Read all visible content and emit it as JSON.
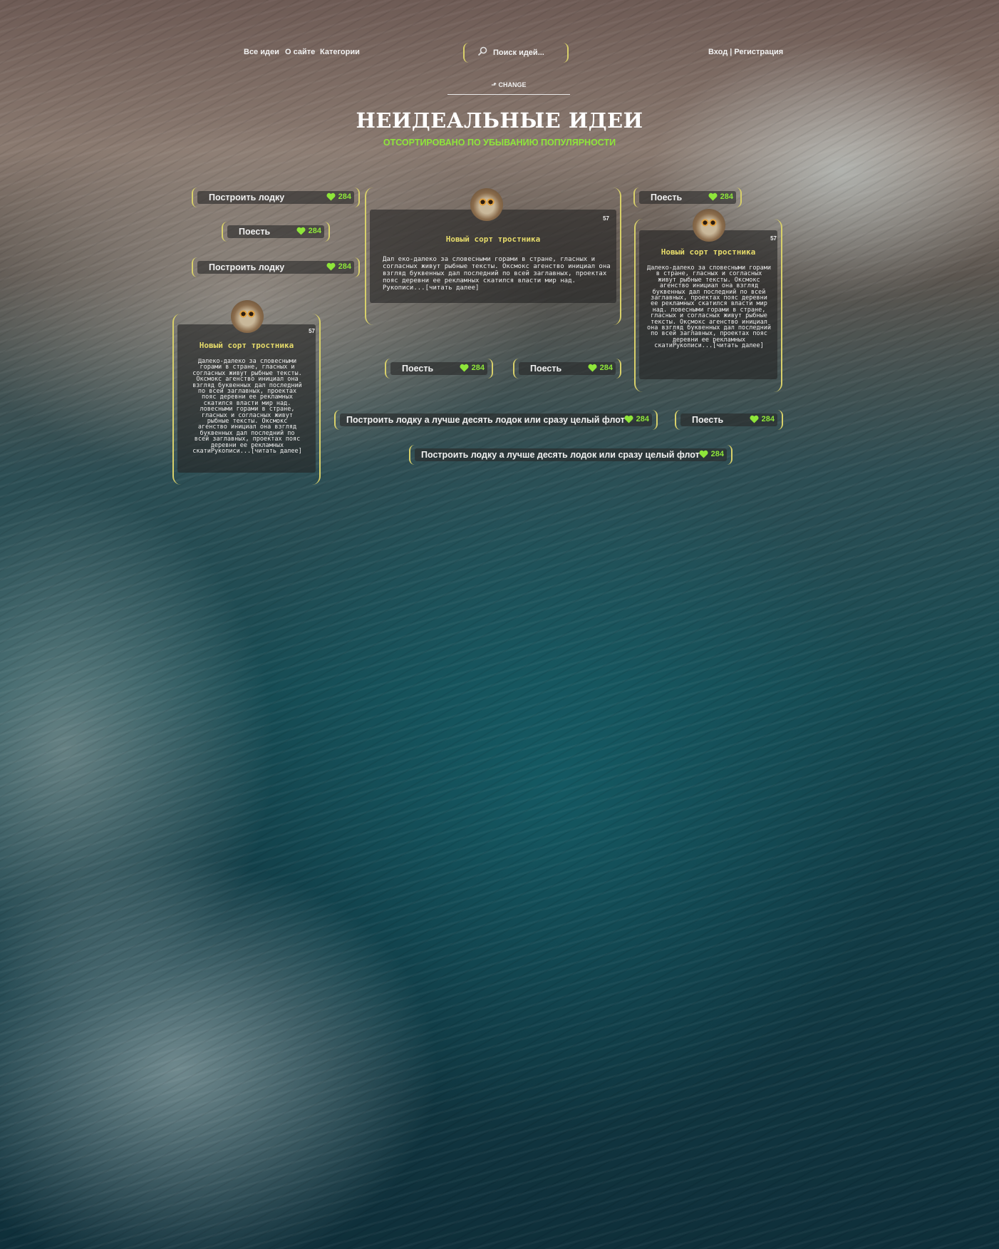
{
  "nav": {
    "items": [
      "Все идеи",
      "О сайте",
      "Категории"
    ]
  },
  "search": {
    "placeholder": "Поиск идей..."
  },
  "auth": {
    "login": "Вход",
    "separator": "|",
    "register": "Регистрация"
  },
  "change_label": "CHANGE",
  "heading": {
    "title": "НЕИДЕАЛЬНЫЕ ИДЕИ",
    "subtitle": "ОТСОРТИРОВАНО ПО УБЫВАНИЮ ПОПУЛЯРНОСТИ"
  },
  "colors": {
    "accent": "#8ee63a",
    "frame": "#d8d06a",
    "card_title": "#e6db6a"
  },
  "pills": [
    {
      "title": "Построить лодку",
      "likes": "284"
    },
    {
      "title": "Поесть",
      "likes": "284"
    },
    {
      "title": "Построить лодку",
      "likes": "284"
    },
    {
      "title": "Поесть",
      "likes": "284"
    },
    {
      "title": "Поесть",
      "likes": "284"
    },
    {
      "title": "Поесть",
      "likes": "284"
    },
    {
      "title": "Построить лодку а лучше десять лодок или сразу целый флот",
      "likes": "284"
    },
    {
      "title": "Поесть",
      "likes": "284"
    },
    {
      "title": "Построить лодку а лучше десять лодок или сразу целый флот",
      "likes": "284"
    }
  ],
  "cards": [
    {
      "number": "57",
      "title": "Новый сорт тростника",
      "text": "Дал еко-далеко за словесными горами в стране, гласных и согласных живут рыбные тексты. Оксмокс агенство инициал она взгляд буквенных дал последний по всей заглавных, проектах пояс деревни ее рекламных скатился власти мир над. Рукописи...[читать далее]"
    },
    {
      "number": "57",
      "title": "Новый сорт тростника",
      "text": "Далеко-далеко за словесными горами в стране, гласных и согласных живут рыбные тексты. Оксмокс агенство инициал она взгляд буквенных дал последний по всей заглавных, проектах пояс деревни ее рекламных скатился власти мир над. ловесными горами в стране, гласных и согласных живут рыбные тексты. Оксмокс агенство инициал она взгляд буквенных дал последний по всей заглавных, проектах пояс деревни ее рекламных скатиРукописи...[читать далее]"
    },
    {
      "number": "57",
      "title": "Новый сорт тростника",
      "text": "Далеко-далеко за словесными горами в стране, гласных и согласных живут рыбные тексты. Оксмокс агенство инициал она взгляд буквенных дал последний по всей заглавных, проектах пояс деревни ее рекламных скатился власти мир над. ловесными горами в стране, гласных и согласных живут рыбные тексты. Оксмокс агенство инициал она взгляд буквенных дал последний по всей заглавных, проектах пояс деревни ее рекламных скатиРукописи...[читать далее]"
    }
  ]
}
